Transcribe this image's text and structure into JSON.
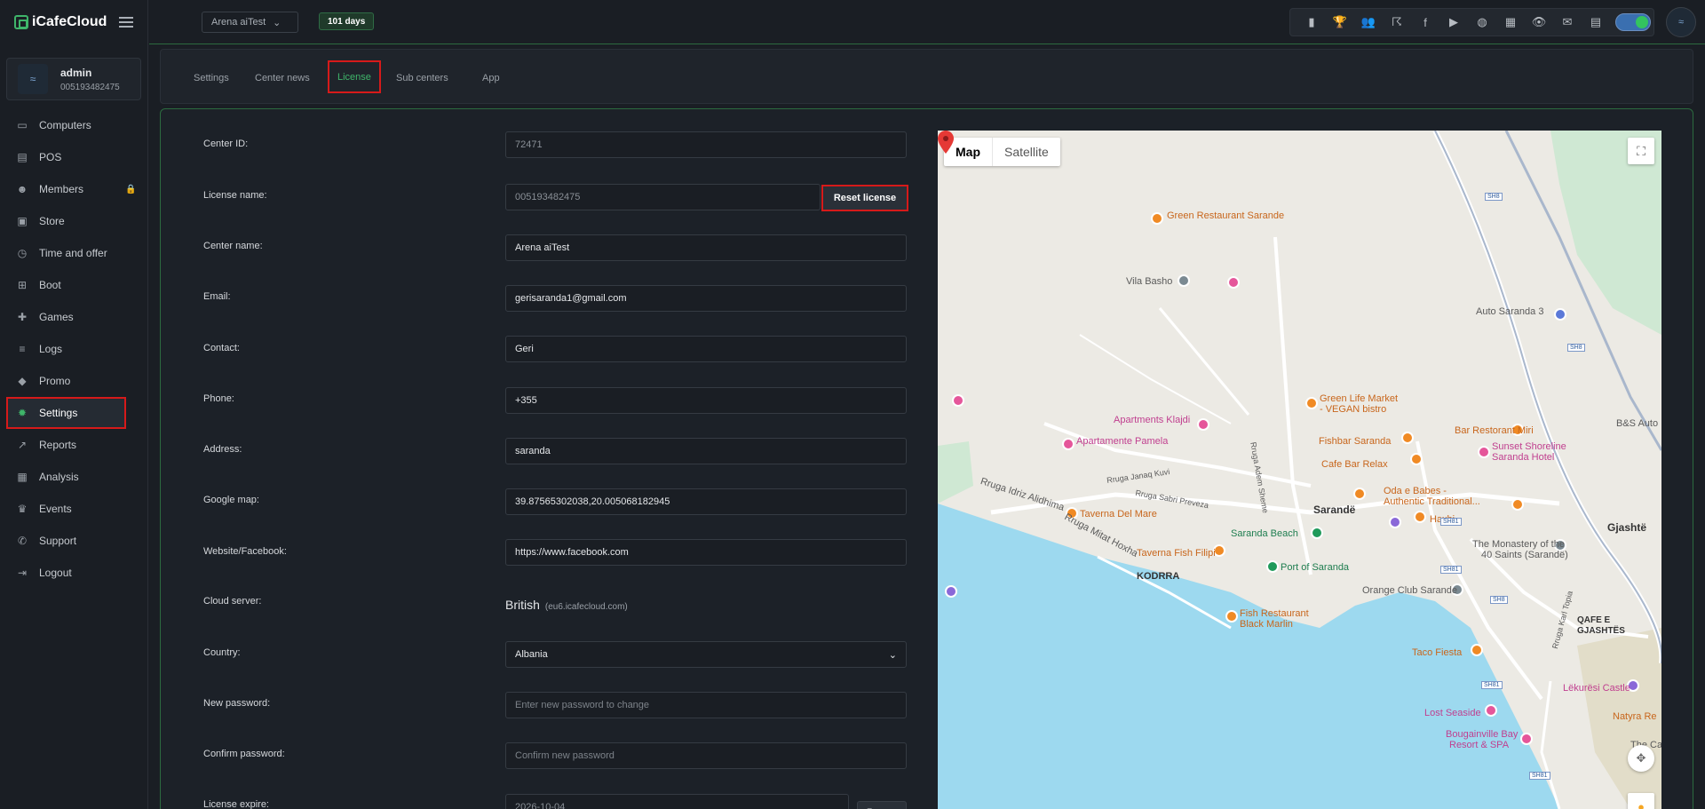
{
  "app": {
    "logo_text": "iCafeCloud"
  },
  "user": {
    "name": "admin",
    "id": "005193482475",
    "avatar_text": "≈"
  },
  "sidebar": {
    "items": [
      {
        "label": "Computers",
        "icon": "▭"
      },
      {
        "label": "POS",
        "icon": "▤"
      },
      {
        "label": "Members",
        "icon": "☻"
      },
      {
        "label": "Store",
        "icon": "▣"
      },
      {
        "label": "Time and offer",
        "icon": "◷"
      },
      {
        "label": "Boot",
        "icon": "⊞"
      },
      {
        "label": "Games",
        "icon": "✚"
      },
      {
        "label": "Logs",
        "icon": "≡"
      },
      {
        "label": "Promo",
        "icon": "◆"
      },
      {
        "label": "Settings",
        "icon": "✹"
      },
      {
        "label": "Reports",
        "icon": "↗"
      },
      {
        "label": "Analysis",
        "icon": "▦"
      },
      {
        "label": "Events",
        "icon": "♛"
      },
      {
        "label": "Support",
        "icon": "✆"
      },
      {
        "label": "Logout",
        "icon": "⇥"
      }
    ],
    "members_badge": "🔒"
  },
  "topbar": {
    "center_select": "Arena aiTest",
    "days": "101 days",
    "icons": [
      "▮",
      "🏆",
      "👥",
      "☈",
      "f",
      "▶",
      "◍",
      "▦",
      "👁",
      "✉",
      "▤"
    ]
  },
  "tabs": [
    "Settings",
    "Center news",
    "License",
    "Sub centers",
    "App"
  ],
  "form": {
    "center_id_label": "Center ID:",
    "center_id": "72471",
    "license_name_label": "License name:",
    "license_name": "005193482475",
    "reset_license": "Reset license",
    "center_name_label": "Center name:",
    "center_name": "Arena aiTest",
    "email_label": "Email:",
    "email": "gerisaranda1@gmail.com",
    "contact_label": "Contact:",
    "contact": "Geri",
    "phone_label": "Phone:",
    "phone": "+355",
    "address_label": "Address:",
    "address": "saranda",
    "google_map_label": "Google map:",
    "google_map": "39.87565302038,20.005068182945",
    "website_label": "Website/Facebook:",
    "website": "https://www.facebook.com",
    "cloud_server_label": "Cloud server:",
    "cloud_server": "British",
    "cloud_server_host": "(eu6.icafecloud.com)",
    "country_label": "Country:",
    "country": "Albania",
    "new_password_label": "New password:",
    "new_password_placeholder": "Enter new password to change",
    "confirm_password_label": "Confirm password:",
    "confirm_password_placeholder": "Confirm new password",
    "license_expire_label": "License expire:",
    "license_expire": "2026-10-04",
    "renew": "Renew"
  },
  "map": {
    "map_btn": "Map",
    "satellite_btn": "Satellite",
    "labels": {
      "green_restaurant": "Green Restaurant Sarande",
      "vila_basho": "Vila Basho",
      "auto_saranda": "Auto Saranda 3",
      "green_life": "Green Life Market",
      "vegan_bistro": "- VEGAN bistro",
      "bar_restorant": "Bar Restorant Miri",
      "bs_auto": "B&S Auto",
      "apartments_klajdi": "Apartments Klajdi",
      "apartamente_pamela": "Apartamente Pamela",
      "fishbar": "Fishbar Saranda",
      "sunset": "Sunset Shoreline",
      "saranda_hotel": "Saranda Hotel",
      "cafe_bar_relax": "Cafe Bar Relax",
      "oda_babes": "Oda e Babes -",
      "authentic": "Authentic Traditional...",
      "rruga_idriz": "Rruga Idriz Alidhima",
      "rruga_janaq": "Rruga Janaq Kuvi",
      "rruga_sabri": "Rruga Sabri Preveza",
      "taverna_del_mare": "Taverna Del Mare",
      "sarande": "Sarandë",
      "haxhi": "Haxhi",
      "gjashte": "Gjashtë",
      "saranda_beach": "Saranda Beach",
      "monastery": "The Monastery of the",
      "forty_saints": "40 Saints (Sarandë)",
      "rruga_mitat": "Rruga Mitat Hoxha",
      "taverna_fish": "Taverna Fish Filipi",
      "port_saranda": "Port of Saranda",
      "kodrra": "KODRRA",
      "orange_club": "Orange Club Sarande",
      "fish_restaurant": "Fish Restaurant",
      "black_marlin": "Black Marlin",
      "qafe": "QAFE E",
      "gjashtes": "GJASHTËS",
      "taco_fiesta": "Taco Fiesta",
      "lekuresi": "Lëkurësi Castle",
      "lost_seaside": "Lost Seaside",
      "natyra": "Natyra Re",
      "bougainville": "Bougainville Bay",
      "resort_spa": "Resort & SPA",
      "the_cas": "The Cas",
      "rruga_adem": "Rruga Adem Sheme",
      "rruga_karl": "Rruga Karl Topia",
      "sh8": "SH8",
      "sh81": "SH81"
    }
  }
}
